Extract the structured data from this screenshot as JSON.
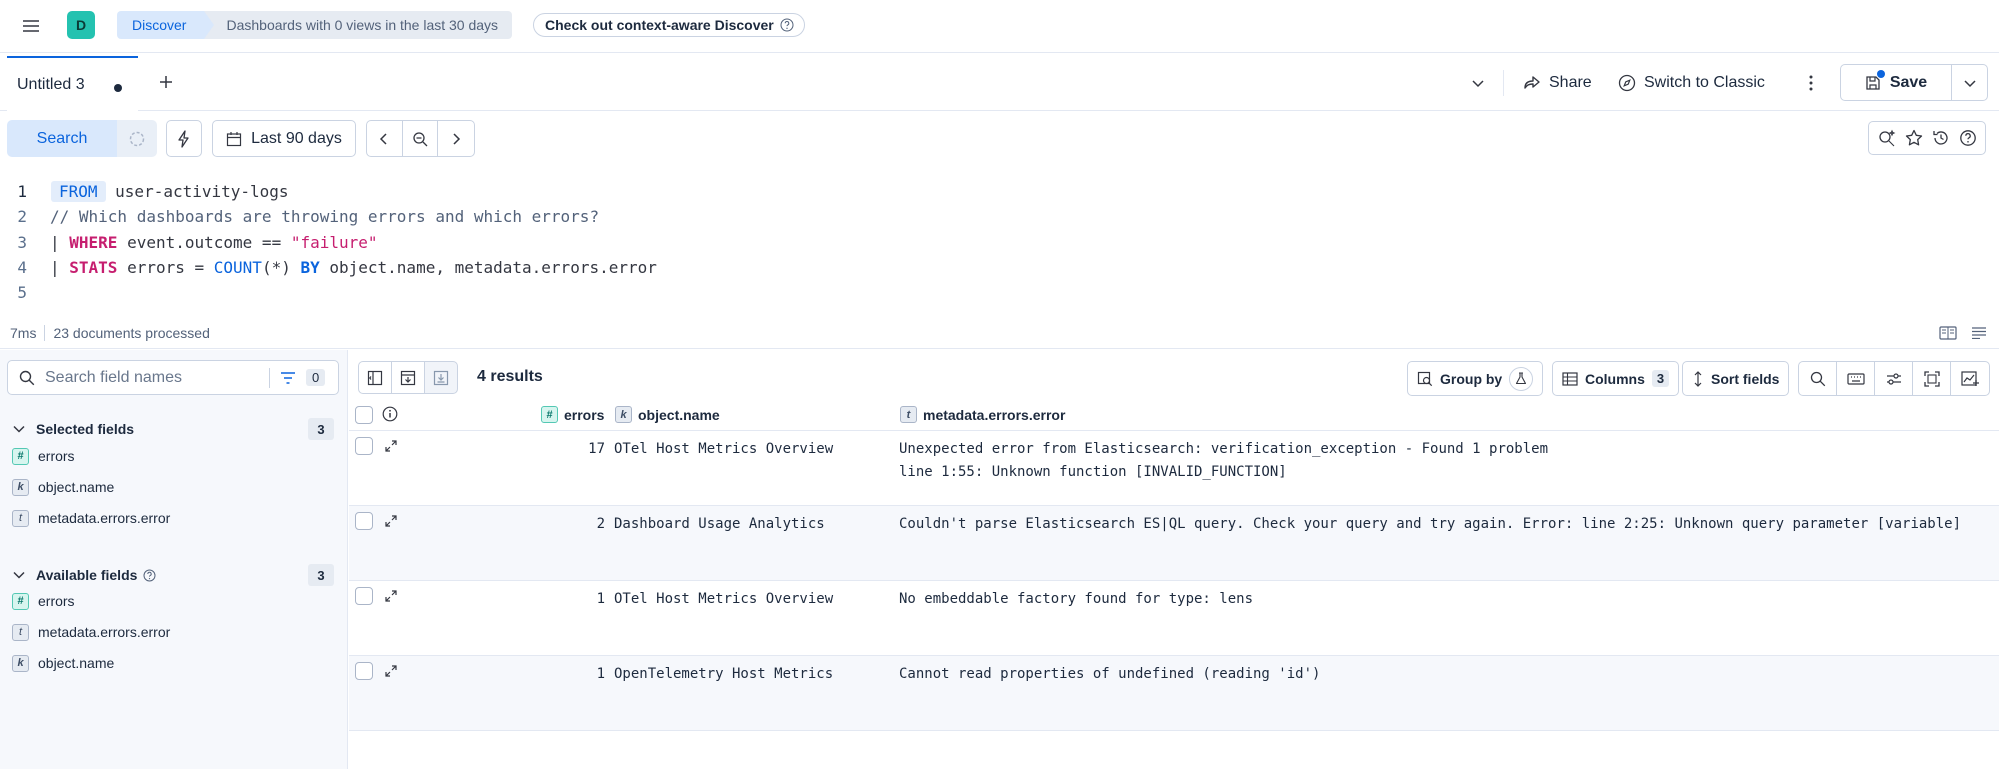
{
  "app": {
    "avatar_letter": "D"
  },
  "breadcrumb": {
    "first": "Discover",
    "second": "Dashboards with 0 views in the last 30 days"
  },
  "context_badge": "Check out context-aware Discover",
  "tabs": {
    "active_label": "Untitled 3"
  },
  "top_actions": {
    "share": "Share",
    "switch": "Switch to Classic",
    "save": "Save"
  },
  "query_bar": {
    "search_label": "Search",
    "date_range": "Last 90 days"
  },
  "editor": {
    "lines": [
      "1",
      "2",
      "3",
      "4",
      "5"
    ],
    "from_kw": "FROM",
    "index": " user-activity-logs",
    "comment": "// Which dashboards are throwing errors and which errors?",
    "pipe": "| ",
    "where_kw": "WHERE",
    "where_expr": " event.outcome == ",
    "where_value": "\"failure\"",
    "stats_kw": "STATS",
    "stats_expr": " errors = ",
    "count_fn": "COUNT",
    "count_arg": "(*) ",
    "by_kw": "BY",
    "by_expr": " object.name, metadata.errors.error"
  },
  "status": {
    "time": "7ms",
    "processed": "23 documents processed"
  },
  "sidebar": {
    "search_placeholder": "Search field names",
    "filter_count": "0",
    "selected_title": "Selected fields",
    "selected_count": "3",
    "selected_fields": [
      {
        "type": "#",
        "name": "errors"
      },
      {
        "type": "k",
        "name": "object.name"
      },
      {
        "type": "t",
        "name": "metadata.errors.error"
      }
    ],
    "available_title": "Available fields",
    "available_count": "3",
    "available_fields": [
      {
        "type": "#",
        "name": "errors"
      },
      {
        "type": "t",
        "name": "metadata.errors.error"
      },
      {
        "type": "k",
        "name": "object.name"
      }
    ]
  },
  "grid": {
    "results": "4 results",
    "group_by": "Group by",
    "columns": "Columns",
    "columns_count": "3",
    "sort_fields": "Sort fields",
    "headers": {
      "errors_type": "#",
      "errors": "errors",
      "object_type": "k",
      "object": "object.name",
      "error_type": "t",
      "error": "metadata.errors.error"
    },
    "rows": [
      {
        "errors": "17",
        "object": "OTel Host Metrics Overview",
        "error": "Unexpected error from Elasticsearch: verification_exception - Found 1 problem\nline 1:55: Unknown function [INVALID_FUNCTION]"
      },
      {
        "errors": "2",
        "object": "Dashboard Usage Analytics",
        "error": "Couldn't parse Elasticsearch ES|QL query. Check your query and try again. Error: line 2:25: Unknown query parameter [variable]"
      },
      {
        "errors": "1",
        "object": "OTel Host Metrics Overview",
        "error": "No embeddable factory found for type: lens"
      },
      {
        "errors": "1",
        "object": "OpenTelemetry Host Metrics",
        "error": "Cannot read properties of undefined (reading 'id')"
      }
    ]
  },
  "colors": {
    "primary": "#0b64dd",
    "accent": "#24c2b0",
    "keyword": "#c61e6f"
  }
}
